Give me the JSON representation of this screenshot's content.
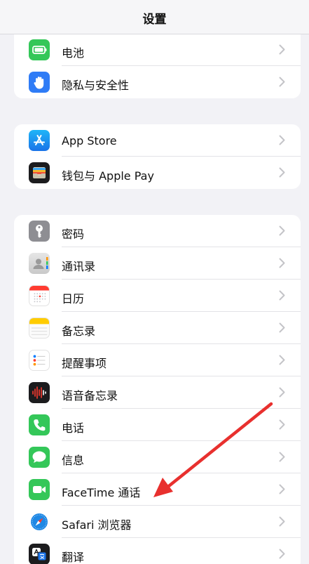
{
  "nav": {
    "title": "设置"
  },
  "groups": [
    {
      "items": [
        {
          "label": "电池",
          "icon": "battery-icon",
          "color": "#34c759"
        },
        {
          "label": "隐私与安全性",
          "icon": "hand-icon",
          "color": "#2f7cf6"
        }
      ]
    },
    {
      "items": [
        {
          "label": "App Store",
          "icon": "app-store-icon",
          "color": "#1a8cf3"
        },
        {
          "label": "钱包与 Apple Pay",
          "icon": "wallet-icon",
          "color": "#1c1c1e"
        }
      ]
    },
    {
      "items": [
        {
          "label": "密码",
          "icon": "key-icon",
          "color": "#8e8e93"
        },
        {
          "label": "通讯录",
          "icon": "contacts-icon",
          "color": "#d8d8d8"
        },
        {
          "label": "日历",
          "icon": "calendar-icon",
          "color": "#ff3b30"
        },
        {
          "label": "备忘录",
          "icon": "notes-icon",
          "color": "#ffcc00"
        },
        {
          "label": "提醒事项",
          "icon": "reminders-icon",
          "color": "#ffffff"
        },
        {
          "label": "语音备忘录",
          "icon": "voice-memos-icon",
          "color": "#1c1c1e"
        },
        {
          "label": "电话",
          "icon": "phone-icon",
          "color": "#34c759"
        },
        {
          "label": "信息",
          "icon": "messages-icon",
          "color": "#34c759"
        },
        {
          "label": "FaceTime 通话",
          "icon": "facetime-icon",
          "color": "#34c759"
        },
        {
          "label": "Safari 浏览器",
          "icon": "safari-icon",
          "color": "#1e88e5"
        },
        {
          "label": "翻译",
          "icon": "translate-icon",
          "color": "#1c1c1e"
        }
      ]
    }
  ],
  "annotation": {
    "color": "#e8302e",
    "icon": "red-arrow-annotation"
  }
}
